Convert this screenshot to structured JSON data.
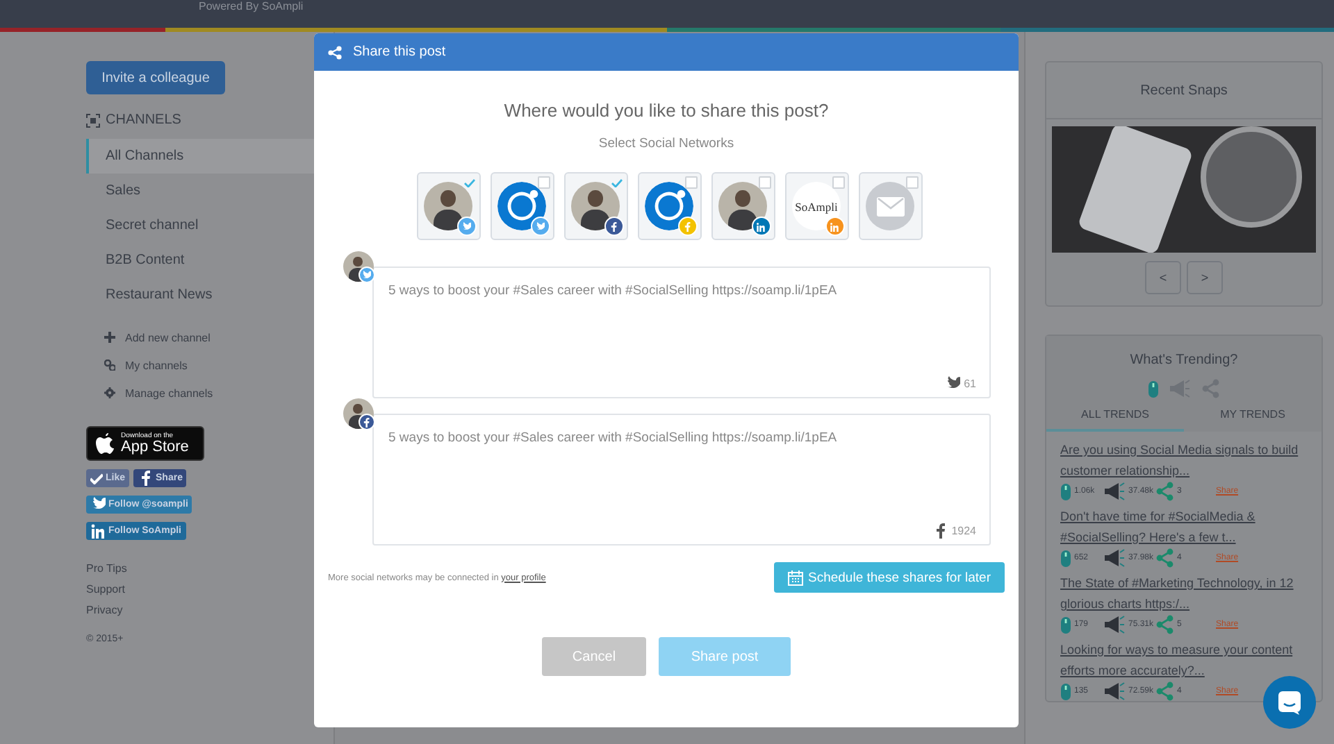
{
  "header": {
    "powered_by": "Powered By SoAmpli"
  },
  "sidebar": {
    "invite_button": "Invite a colleague",
    "channels_title": "CHANNELS",
    "channels": [
      {
        "label": "All Channels",
        "selected": true
      },
      {
        "label": "Sales",
        "selected": false
      },
      {
        "label": "Secret channel",
        "selected": false
      },
      {
        "label": "B2B Content",
        "selected": false
      },
      {
        "label": "Restaurant News",
        "selected": false
      }
    ],
    "actions": [
      {
        "kind": "add",
        "label": "Add new channel"
      },
      {
        "kind": "link",
        "label": "My channels"
      },
      {
        "kind": "gear",
        "label": "Manage channels"
      }
    ],
    "app_store": {
      "small": "Download on the",
      "big": "App Store"
    },
    "social_buttons": [
      {
        "kind": "like",
        "label": "Like"
      },
      {
        "kind": "fbshare",
        "label": "Share"
      },
      {
        "kind": "twitter",
        "label": "Follow @soampli"
      },
      {
        "kind": "linkedin",
        "label": "Follow SoAmpli"
      }
    ],
    "links": [
      "Pro Tips",
      "Support",
      "Privacy"
    ],
    "copyright": "© 2015+"
  },
  "modal": {
    "title": "Share this post",
    "question": "Where would you like to share this post?",
    "subtitle": "Select Social Networks",
    "networks": [
      {
        "kind": "photo",
        "badge": {
          "kind": "twitter"
        },
        "checked": true
      },
      {
        "kind": "logo",
        "badge": {
          "kind": "twitter"
        },
        "checked": false
      },
      {
        "kind": "photo",
        "badge": {
          "kind": "facebook"
        },
        "checked": true
      },
      {
        "kind": "logo",
        "badge": {
          "kind": "fbpage"
        },
        "checked": false
      },
      {
        "kind": "photo",
        "badge": {
          "kind": "linkedin"
        },
        "checked": false
      },
      {
        "kind": "brand",
        "brand_text": "SoAmpli",
        "badge": {
          "kind": "linkedinpage"
        },
        "checked": false
      },
      {
        "kind": "mail",
        "checked": false
      }
    ],
    "posts": [
      {
        "kind": "twitter",
        "text": "5 ways to boost your #Sales career with #SocialSelling https://soamp.li/1pEA",
        "count": "61"
      },
      {
        "kind": "facebook",
        "text": "5 ways to boost your #Sales career with #SocialSelling https://soamp.li/1pEA",
        "count": "1924"
      }
    ],
    "note": "More social networks may be connected in",
    "note_link": "your profile",
    "schedule_button": "Schedule these shares for later",
    "cancel_button": "Cancel",
    "share_button": {
      "label": "Share post",
      "disabled": true
    }
  },
  "recent_snaps": {
    "title": "Recent Snaps",
    "prev": "<",
    "next": ">"
  },
  "trending": {
    "title": "What's Trending?",
    "tabs": [
      {
        "label": "ALL TRENDS",
        "selected": true
      },
      {
        "label": "MY TRENDS",
        "selected": false
      }
    ],
    "items": [
      {
        "title": "Are you using Social Media signals to build customer relationship...",
        "clicks": "1.06k",
        "reach": "37.48k",
        "shares": "3",
        "action": "Share"
      },
      {
        "title": "Don't have time for #SocialMedia & #SocialSelling? Here's a few t...",
        "clicks": "652",
        "reach": "37.98k",
        "shares": "4",
        "action": "Share"
      },
      {
        "title": "The State of #Marketing Technology, in 12 glorious charts https:/...",
        "clicks": "179",
        "reach": "75.31k",
        "shares": "5",
        "action": "Share"
      },
      {
        "title": "Looking for ways to measure your content efforts more accurately?...",
        "clicks": "135",
        "reach": "72.59k",
        "shares": "4",
        "action": "Share"
      }
    ]
  }
}
